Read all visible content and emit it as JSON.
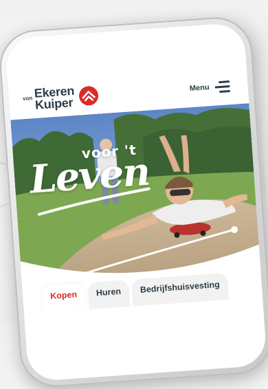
{
  "header": {
    "logo": {
      "prefix": "von",
      "line1": "Ekeren",
      "line2": "Kuiper",
      "mark_color": "#d92b2b"
    },
    "menu_label": "Menu"
  },
  "hero": {
    "tagline_small": "voor 't",
    "tagline_large": "Leven"
  },
  "tabs": [
    {
      "label": "Kopen",
      "active": true
    },
    {
      "label": "Huren",
      "active": false
    },
    {
      "label": "Bedrijfshuisvesting",
      "active": false
    }
  ],
  "colors": {
    "brand_red": "#d92b2b",
    "text_dark": "#2c3d47",
    "menu_icon": "#2c3d47"
  }
}
